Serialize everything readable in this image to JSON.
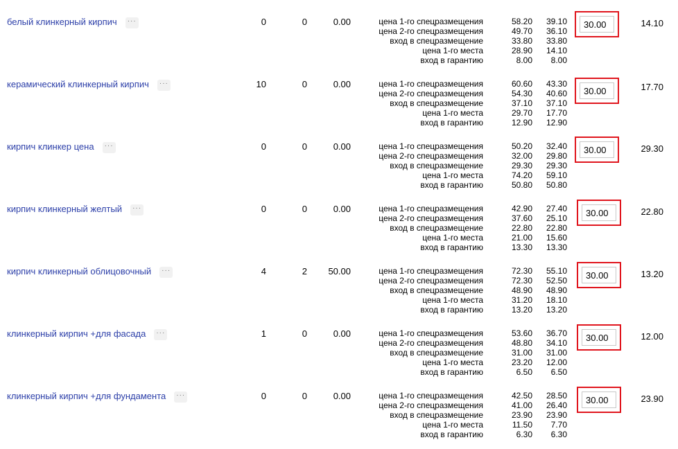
{
  "price_labels": [
    "цена 1-го спецразмещения",
    "цена 2-го спецразмещения",
    "вход в спецразмещение",
    "цена 1-го места",
    "вход в гарантию"
  ],
  "more_label": "···",
  "rows": [
    {
      "keyword": "белый клинкерный кирпич",
      "col1": "0",
      "col2": "0",
      "col3": "0.00",
      "prices_a": [
        "58.20",
        "49.70",
        "33.80",
        "28.90",
        "8.00"
      ],
      "prices_b": [
        "39.10",
        "36.10",
        "33.80",
        "14.10",
        "8.00"
      ],
      "bid": "30.00",
      "right_value": "14.10"
    },
    {
      "keyword": "керамический клинкерный кирпич",
      "col1": "10",
      "col2": "0",
      "col3": "0.00",
      "prices_a": [
        "60.60",
        "54.30",
        "37.10",
        "29.70",
        "12.90"
      ],
      "prices_b": [
        "43.30",
        "40.60",
        "37.10",
        "17.70",
        "12.90"
      ],
      "bid": "30.00",
      "right_value": "17.70"
    },
    {
      "keyword": "кирпич клинкер цена",
      "col1": "0",
      "col2": "0",
      "col3": "0.00",
      "prices_a": [
        "50.20",
        "32.00",
        "29.30",
        "74.20",
        "50.80"
      ],
      "prices_b": [
        "32.40",
        "29.80",
        "29.30",
        "59.10",
        "50.80"
      ],
      "bid": "30.00",
      "right_value": "29.30"
    },
    {
      "keyword": "кирпич клинкерный желтый",
      "col1": "0",
      "col2": "0",
      "col3": "0.00",
      "prices_a": [
        "42.90",
        "37.60",
        "22.80",
        "21.00",
        "13.30"
      ],
      "prices_b": [
        "27.40",
        "25.10",
        "22.80",
        "15.60",
        "13.30"
      ],
      "bid": "30.00",
      "right_value": "22.80"
    },
    {
      "keyword": "кирпич клинкерный облицовочный",
      "col1": "4",
      "col2": "2",
      "col3": "50.00",
      "prices_a": [
        "72.30",
        "72.30",
        "48.90",
        "31.20",
        "13.20"
      ],
      "prices_b": [
        "55.10",
        "52.50",
        "48.90",
        "18.10",
        "13.20"
      ],
      "bid": "30.00",
      "right_value": "13.20"
    },
    {
      "keyword": "клинкерный кирпич +для фасада",
      "col1": "1",
      "col2": "0",
      "col3": "0.00",
      "prices_a": [
        "53.60",
        "48.80",
        "31.00",
        "23.20",
        "6.50"
      ],
      "prices_b": [
        "36.70",
        "34.10",
        "31.00",
        "12.00",
        "6.50"
      ],
      "bid": "30.00",
      "right_value": "12.00"
    },
    {
      "keyword": "клинкерный кирпич +для фундамента",
      "col1": "0",
      "col2": "0",
      "col3": "0.00",
      "prices_a": [
        "42.50",
        "41.00",
        "23.90",
        "11.50",
        "6.30"
      ],
      "prices_b": [
        "28.50",
        "26.40",
        "23.90",
        "7.70",
        "6.30"
      ],
      "bid": "30.00",
      "right_value": "23.90"
    }
  ]
}
